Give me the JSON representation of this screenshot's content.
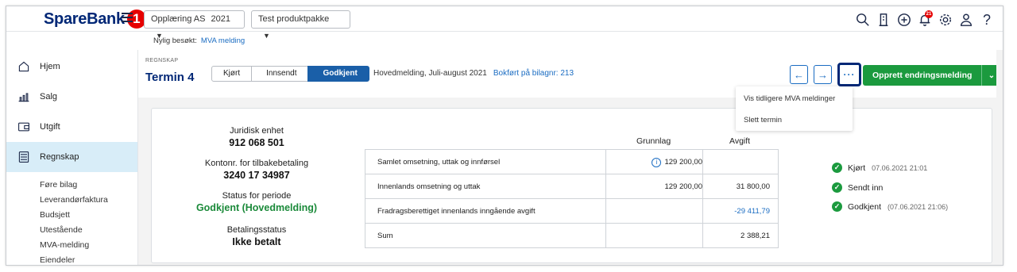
{
  "app": {
    "brand": "SpareBank",
    "brand_badge": "1"
  },
  "topbar": {
    "company_select": {
      "label": "Opplæring AS",
      "year": "2021"
    },
    "package_select": "Test produktpakke",
    "notification_count": "21",
    "help": "?"
  },
  "recent": {
    "label": "Nylig besøkt:",
    "link": "MVA melding"
  },
  "sidebar": {
    "items": [
      {
        "label": "Hjem"
      },
      {
        "label": "Salg"
      },
      {
        "label": "Utgift"
      },
      {
        "label": "Regnskap"
      }
    ],
    "subitems": [
      "Føre bilag",
      "Leverandørfaktura",
      "Budsjett",
      "Utestående",
      "MVA-melding",
      "Eiendeler"
    ]
  },
  "header": {
    "kicker": "REGNSKAP",
    "title": "Termin 4",
    "steps": [
      "Kjørt",
      "Innsendt",
      "Godkjent"
    ],
    "meta": "Hovedmelding, Juli-august 2021",
    "link": "Bokført på bilagnr: 213",
    "cta": "Opprett endringsmelding",
    "more": "···"
  },
  "menu": [
    "Vis tidligere MVA meldinger",
    "Slett termin"
  ],
  "info": {
    "juridisk_label": "Juridisk enhet",
    "juridisk_value": "912 068 501",
    "konto_label": "Kontonr. for tilbakebetaling",
    "konto_value": "3240 17 34987",
    "status_label": "Status for periode",
    "status_value": "Godkjent (Hovedmelding)",
    "betaling_label": "Betalingsstatus",
    "betaling_value": "Ikke betalt"
  },
  "table": {
    "headers": {
      "grunnlag": "Grunnlag",
      "avgift": "Avgift"
    },
    "rows": [
      {
        "label": "Samlet omsetning, uttak og innførsel",
        "grunnlag": "129 200,00",
        "avgift": ""
      },
      {
        "label": "Innenlands omsetning og uttak",
        "grunnlag": "129 200,00",
        "avgift": "31 800,00"
      },
      {
        "label": "Fradragsberettiget innenlands inngående avgift",
        "grunnlag": "",
        "avgift": "-29 411,79"
      },
      {
        "label": "Sum",
        "grunnlag": "",
        "avgift": "2 388,21"
      }
    ]
  },
  "timeline": [
    {
      "label": "Kjørt",
      "time": "07.06.2021 21:01"
    },
    {
      "label": "Sendt inn",
      "time": ""
    },
    {
      "label": "Godkjent",
      "time": "(07.06.2021 21:06)"
    }
  ],
  "colors": {
    "brand": "#002776",
    "accent": "#1a6cc2",
    "success": "#1b9a3e",
    "active_bg": "#d8edf8"
  }
}
